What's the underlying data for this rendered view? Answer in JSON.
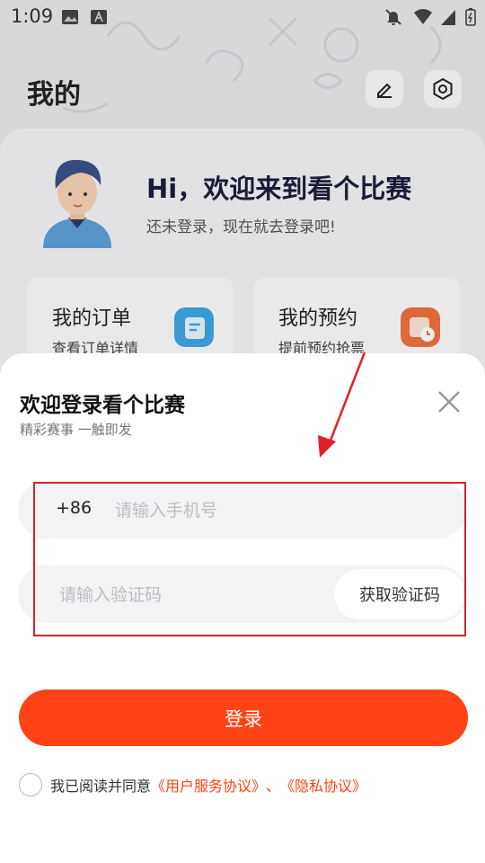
{
  "status_bar": {
    "time": "1:09"
  },
  "header": {
    "title": "我的"
  },
  "profile": {
    "welcome": "Hi，欢迎来到看个比赛",
    "subtitle": "还未登录，现在就去登录吧!"
  },
  "quick_cards": [
    {
      "title": "我的订单",
      "subtitle": "查看订单详情"
    },
    {
      "title": "我的预约",
      "subtitle": "提前预约抢票"
    }
  ],
  "login_sheet": {
    "title": "欢迎登录看个比赛",
    "subtitle": "精彩赛事 一触即发",
    "country_code": "+86",
    "phone_placeholder": "请输入手机号",
    "phone_value": "",
    "code_placeholder": "请输入验证码",
    "code_value": "",
    "get_code_label": "获取验证码",
    "login_label": "登录",
    "agree_text": "我已阅读并同意",
    "user_agreement": "《用户服务协议》",
    "separator": "、",
    "privacy_policy": "《隐私协议》"
  },
  "colors": {
    "accent": "#ff4316",
    "annotation": "#e0212b"
  }
}
